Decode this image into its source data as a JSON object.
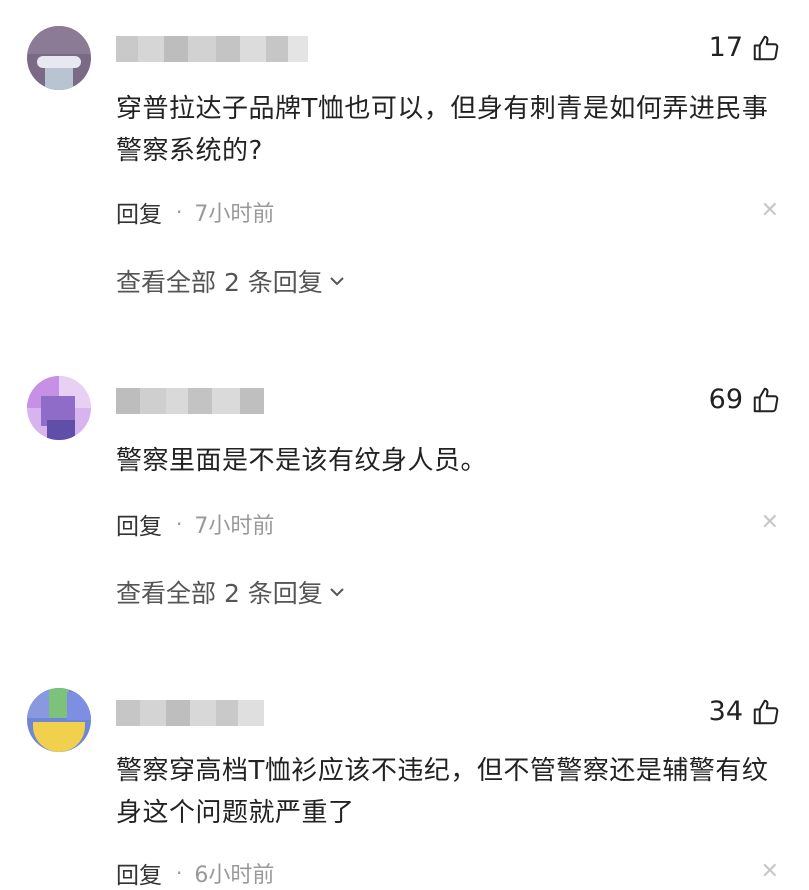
{
  "comments": [
    {
      "likes": "17",
      "text": "穿普拉达子品牌T恤也可以，但身有刺青是如何弄进民事警察系统的?",
      "reply_label": "回复",
      "time": "7小时前",
      "view_replies": "查看全部 2 条回复"
    },
    {
      "likes": "69",
      "text": "警察里面是不是该有纹身人员。",
      "reply_label": "回复",
      "time": "7小时前",
      "view_replies": "查看全部 2 条回复"
    },
    {
      "likes": "34",
      "text": "警察穿高档T恤衫应该不违纪，但不管警察还是辅警有纹身这个问题就严重了",
      "reply_label": "回复",
      "time": "6小时前"
    }
  ],
  "icons": {
    "like": "thumbs-up-icon",
    "close": "close-icon",
    "expand": "chevron-down-icon"
  },
  "colors": {
    "text": "#222222",
    "meta": "#999999",
    "close": "#c8c8c8"
  }
}
